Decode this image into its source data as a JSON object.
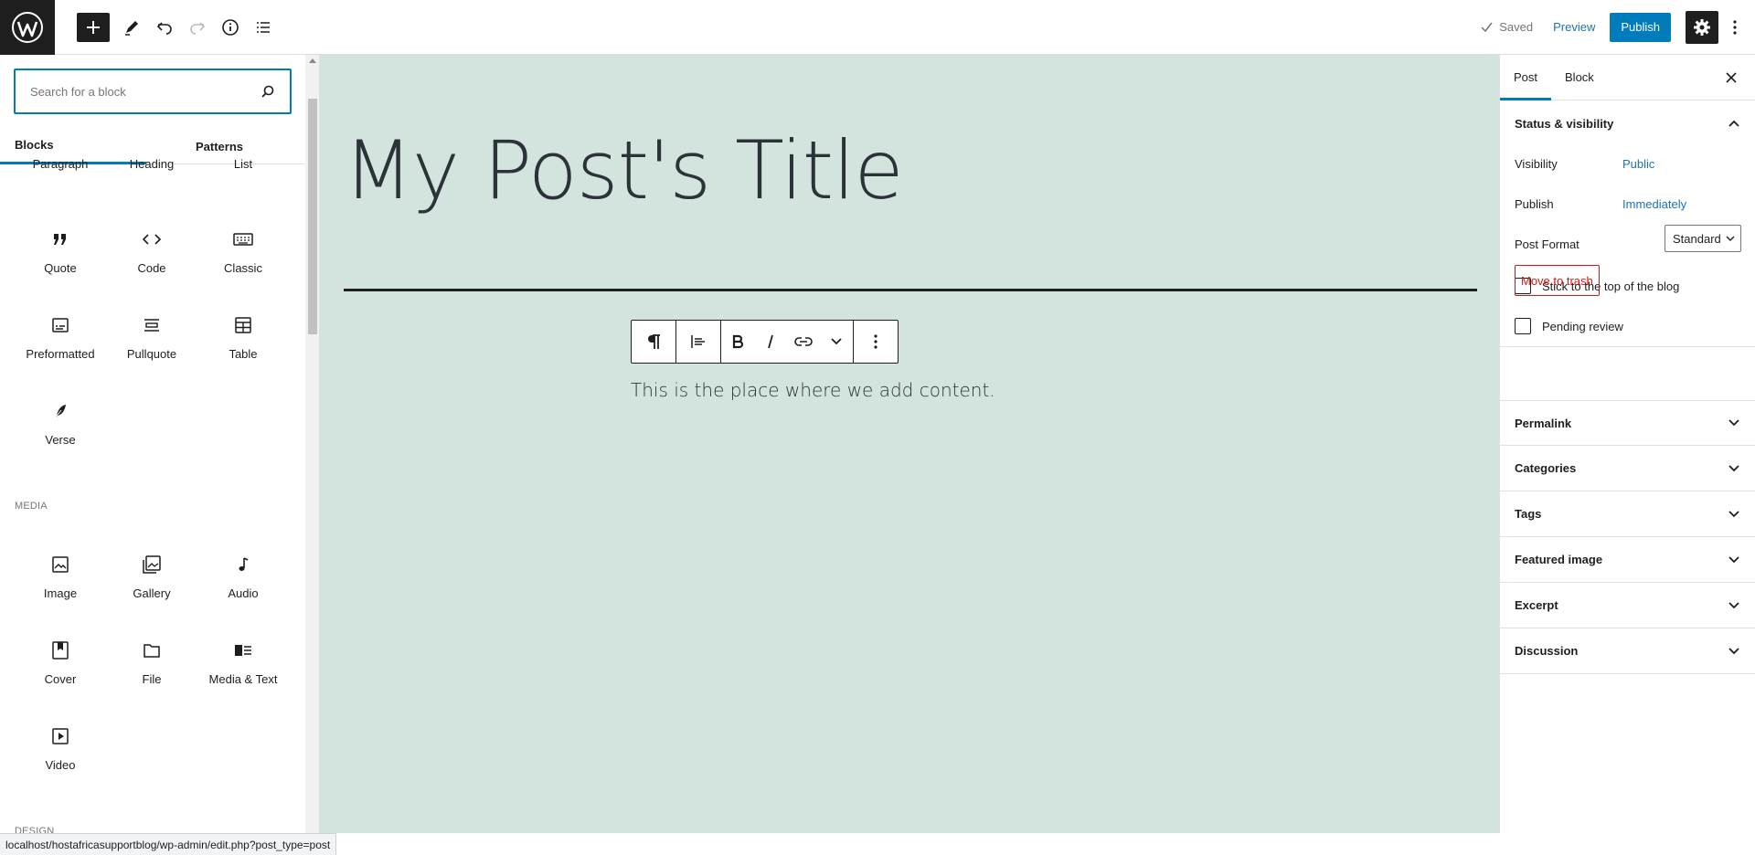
{
  "topbar": {
    "saved_label": "Saved",
    "preview_label": "Preview",
    "publish_label": "Publish"
  },
  "inserter": {
    "search_placeholder": "Search for a block",
    "tabs": [
      "Blocks",
      "Patterns"
    ],
    "text_blocks": [
      {
        "label": "Paragraph",
        "icon": "paragraph-icon"
      },
      {
        "label": "Heading",
        "icon": "heading-icon"
      },
      {
        "label": "List",
        "icon": "list-icon"
      },
      {
        "label": "Quote",
        "icon": "quote-icon"
      },
      {
        "label": "Code",
        "icon": "code-icon"
      },
      {
        "label": "Classic",
        "icon": "keyboard-icon"
      },
      {
        "label": "Preformatted",
        "icon": "preformatted-icon"
      },
      {
        "label": "Pullquote",
        "icon": "pullquote-icon"
      },
      {
        "label": "Table",
        "icon": "table-icon"
      },
      {
        "label": "Verse",
        "icon": "feather-icon"
      }
    ],
    "media_section_label": "MEDIA",
    "media_blocks": [
      {
        "label": "Image",
        "icon": "image-icon"
      },
      {
        "label": "Gallery",
        "icon": "gallery-icon"
      },
      {
        "label": "Audio",
        "icon": "audio-icon"
      },
      {
        "label": "Cover",
        "icon": "cover-icon"
      },
      {
        "label": "File",
        "icon": "file-icon"
      },
      {
        "label": "Media & Text",
        "icon": "media-text-icon"
      },
      {
        "label": "Video",
        "icon": "video-icon"
      }
    ],
    "design_section_label": "DESIGN"
  },
  "canvas": {
    "post_title": "My Post's Title",
    "paragraph": "This is the place where we add content.",
    "background_color": "#d2e4dd"
  },
  "sidebar": {
    "tabs": [
      "Post",
      "Block"
    ],
    "status_visibility": {
      "title": "Status & visibility",
      "visibility_label": "Visibility",
      "visibility_value": "Public",
      "publish_label": "Publish",
      "publish_value": "Immediately",
      "post_format_label": "Post Format",
      "post_format_value": "Standard",
      "stick_label": "Stick to the top of the blog",
      "pending_label": "Pending review",
      "trash_label": "Move to trash"
    },
    "panels": [
      "Permalink",
      "Categories",
      "Tags",
      "Featured image",
      "Excerpt",
      "Discussion"
    ]
  },
  "statusbar": {
    "url": "localhost/hostafricasupportblog/wp-admin/edit.php?post_type=post"
  },
  "colors": {
    "accent": "#007cba",
    "dark": "#1e1e1e",
    "danger": "#cc1818"
  }
}
